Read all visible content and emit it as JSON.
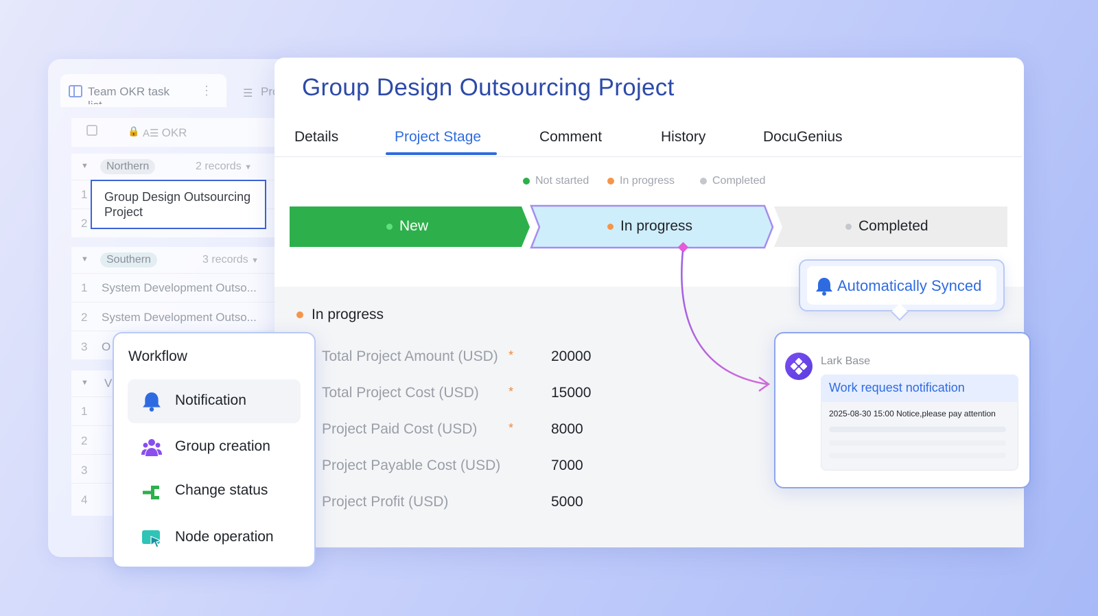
{
  "background_table": {
    "tab_title": "Team OKR task list",
    "tab2_title": "Pro",
    "column_header": "OKR",
    "groups": [
      {
        "name": "Northern",
        "records": "2 records"
      },
      {
        "name": "Southern",
        "records": "3 records"
      }
    ],
    "selected_cell": "Group Design Outsourcing Project",
    "southern_rows": [
      {
        "num": "1",
        "text": "System Development Outso..."
      },
      {
        "num": "2",
        "text": "System Development Outso..."
      },
      {
        "num": "3",
        "text": "O"
      }
    ],
    "row_numbers": [
      "1",
      "2",
      "1",
      "2",
      "3",
      "4"
    ],
    "third_group_initial": "V"
  },
  "main": {
    "title": "Group Design Outsourcing Project",
    "tabs": [
      "Details",
      "Project Stage",
      "Comment",
      "History",
      "DocuGenius"
    ],
    "active_tab": "Project Stage",
    "legend": [
      {
        "label": "Not started",
        "color": "#2db04b"
      },
      {
        "label": "In progress",
        "color": "#f5954a"
      },
      {
        "label": "Completed",
        "color": "#c4c7cd"
      }
    ],
    "stages": [
      {
        "label": "New",
        "state": "done"
      },
      {
        "label": "In progress",
        "state": "current"
      },
      {
        "label": "Completed",
        "state": "todo"
      }
    ],
    "current_stage": "In progress",
    "fields": [
      {
        "label": "Total Project Amount (USD)",
        "required": true,
        "value": "20000"
      },
      {
        "label": "Total Project Cost (USD)",
        "required": true,
        "value": "15000"
      },
      {
        "label": "Project Paid Cost (USD)",
        "required": true,
        "value": "8000"
      },
      {
        "label": "Project Payable Cost (USD)",
        "required": false,
        "value": "7000"
      },
      {
        "label": "Project Profit (USD)",
        "required": false,
        "value": "5000"
      }
    ]
  },
  "sync": {
    "label": "Automatically Synced",
    "icon": "bell-icon"
  },
  "notification": {
    "app": "Lark Base",
    "title": "Work request notification",
    "message": "2025-08-30 15:00 Notice,please pay attention"
  },
  "workflow": {
    "title": "Workflow",
    "items": [
      {
        "label": "Notification",
        "icon": "bell-icon"
      },
      {
        "label": "Group creation",
        "icon": "group-icon"
      },
      {
        "label": "Change status",
        "icon": "change-status-icon"
      },
      {
        "label": "Node operation",
        "icon": "node-operation-icon"
      }
    ]
  },
  "colors": {
    "accent": "#2f6be0",
    "stage_done": "#2db04b",
    "stage_current": "#cfeefb",
    "stage_todo": "#ededed"
  }
}
